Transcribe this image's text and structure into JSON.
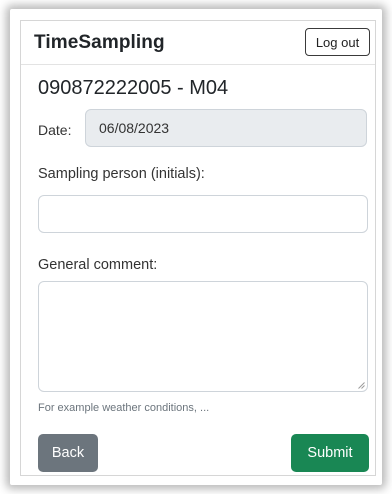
{
  "navbar": {
    "brand": "TimeSampling",
    "logout_label": "Log out"
  },
  "page": {
    "title": "090872222005 - M04"
  },
  "form": {
    "date_label": "Date:",
    "date_value": "06/08/2023",
    "sampling_person_label": "Sampling person (initials):",
    "sampling_person_value": "",
    "general_comment_label": "General comment:",
    "general_comment_value": "",
    "general_comment_help": "For example weather conditions, ..."
  },
  "actions": {
    "back_label": "Back",
    "submit_label": "Submit"
  },
  "colors": {
    "secondary": "#6c757d",
    "success": "#198754",
    "disabled_input": "#e9ecef"
  }
}
